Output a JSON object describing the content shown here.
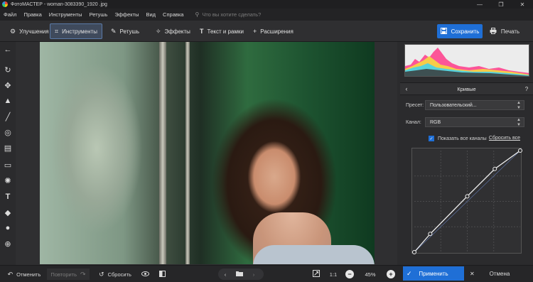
{
  "window": {
    "title": "ФотоМАСТЕР - woman-3083390_1920 .jpg",
    "minimize": "—",
    "maximize": "❐",
    "close": "✕"
  },
  "menu": {
    "items": [
      "Файл",
      "Правка",
      "Инструменты",
      "Ретушь",
      "Эффекты",
      "Вид",
      "Справка"
    ],
    "search_placeholder": "Что вы хотите сделать?"
  },
  "tabs": [
    {
      "label": "Улучшения",
      "icon": "sliders-icon",
      "glyph": "⚙"
    },
    {
      "label": "Инструменты",
      "icon": "crop-icon",
      "glyph": "⌗"
    },
    {
      "label": "Ретушь",
      "icon": "brush-icon",
      "glyph": "✎"
    },
    {
      "label": "Эффекты",
      "icon": "magic-wand-icon",
      "glyph": "✧"
    },
    {
      "label": "Текст и рамки",
      "icon": "text-icon",
      "glyph": "T"
    },
    {
      "label": "Расширения",
      "icon": "plus-icon",
      "glyph": "+"
    }
  ],
  "actions": {
    "save_label": "Сохранить",
    "print_label": "Печать"
  },
  "left_tools": [
    {
      "name": "back-arrow-icon",
      "glyph": "←"
    },
    {
      "name": "rotate-icon",
      "glyph": "↻"
    },
    {
      "name": "healing-brush-icon",
      "glyph": "✥"
    },
    {
      "name": "stamp-icon",
      "glyph": "▲"
    },
    {
      "name": "brush-icon",
      "glyph": "╱"
    },
    {
      "name": "radial-filter-icon",
      "glyph": "◎"
    },
    {
      "name": "gradient-filter-icon",
      "glyph": "▤"
    },
    {
      "name": "vignette-icon",
      "glyph": "▭"
    },
    {
      "name": "light-icon",
      "glyph": "✺"
    },
    {
      "name": "text-tool-icon",
      "glyph": "T"
    },
    {
      "name": "fill-icon",
      "glyph": "◆"
    },
    {
      "name": "blur-icon",
      "glyph": "●"
    },
    {
      "name": "color-wheel-icon",
      "glyph": "⊕"
    }
  ],
  "curves": {
    "title": "Кривые",
    "back": "‹",
    "help": "?",
    "preset_label": "Пресет:",
    "preset_value": "Пользовательский...",
    "channel_label": "Канал:",
    "channel_value": "RGB",
    "show_all_channels": "Показать все каналы",
    "reset_all": "Сбросить все",
    "points": [
      [
        0,
        0
      ],
      [
        0.15,
        0.18
      ],
      [
        0.5,
        0.55
      ],
      [
        0.76,
        0.82
      ],
      [
        1,
        1
      ]
    ]
  },
  "bottom": {
    "undo": "Отменить",
    "redo": "Повторить",
    "reset": "Сбросить",
    "zoom_ratio": "1:1",
    "zoom_percent": "45%",
    "apply": "Применить",
    "cancel": "Отмена"
  },
  "colors": {
    "accent": "#1f6fd6",
    "background": "#2b2b2d"
  }
}
